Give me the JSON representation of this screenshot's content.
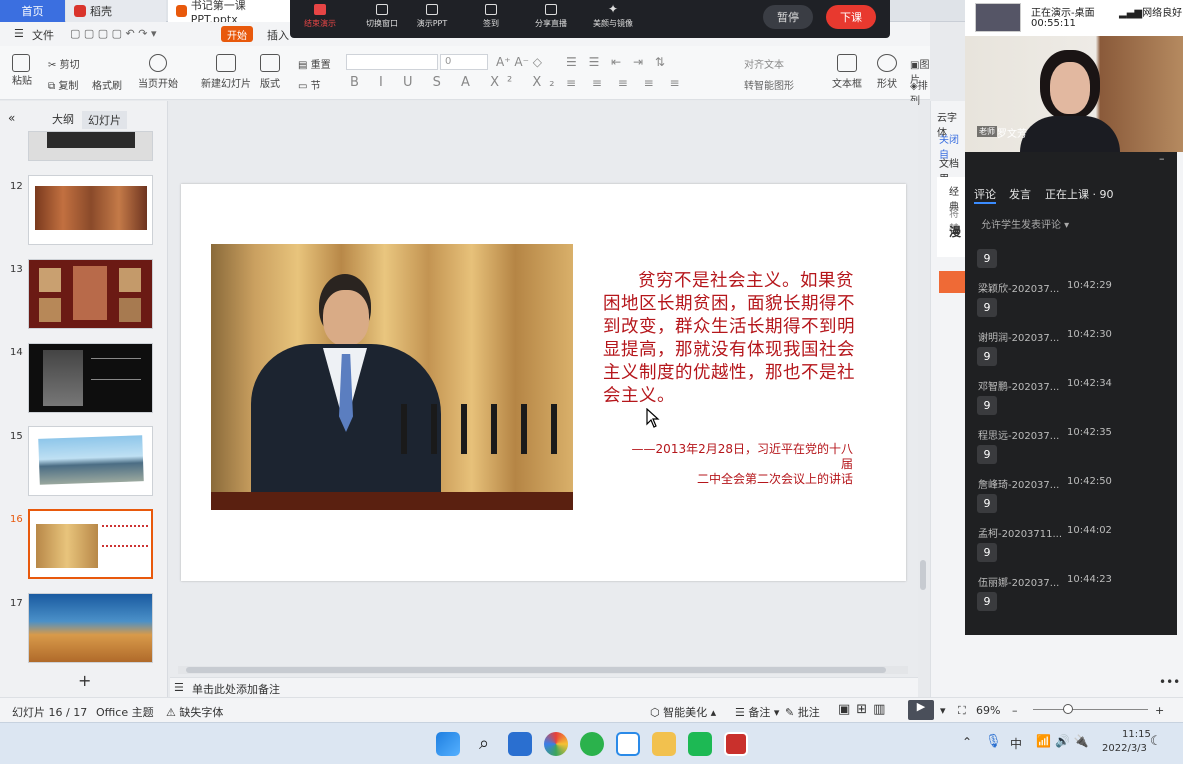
{
  "tabs": {
    "home": "首页",
    "daoke": "稻壳",
    "file": "书记第一课PPT.pptx"
  },
  "meeting": {
    "buttons": [
      "结束演示",
      "切换窗口",
      "演示PPT",
      "签到",
      "分享直播",
      "美颜与镜像"
    ],
    "pause": "暂停",
    "end_class": "下课"
  },
  "menu": {
    "file": "文件",
    "start": "开始",
    "insert": "插入"
  },
  "ribbon": {
    "paste": "粘贴",
    "cut": "剪切",
    "copy": "复制",
    "format_painter": "格式刷",
    "from_start": "当页开始",
    "new_slide": "新建幻灯片",
    "layout": "版式",
    "reset": "重置",
    "section": "节",
    "font_size": "0",
    "align_text": "对齐文本",
    "smart_graphic": "转智能图形",
    "textbox": "文本框",
    "shape": "形状",
    "picture": "图片",
    "arrange": "排列"
  },
  "left_panel": {
    "tab_outline": "大纲",
    "tab_slides": "幻灯片",
    "thumbs": [
      {
        "num": "12"
      },
      {
        "num": "13"
      },
      {
        "num": "14"
      },
      {
        "num": "15"
      },
      {
        "num": "16"
      },
      {
        "num": "17"
      }
    ],
    "add": "+"
  },
  "slide": {
    "quote": "贫穷不是社会主义。如果贫困地区长期贫困，面貌长期得不到改变，群众生活长期得不到明显提高，那就没有体现我国社会主义制度的优越性，那也不是社会主义。",
    "source_line1": "——2013年2月28日，习近平在党的十八届",
    "source_line2": "二中全会第二次会议上的讲话"
  },
  "notes": {
    "placeholder": "单击此处添加备注"
  },
  "right_side": {
    "cloud_font": "云字体",
    "close": "关闭自",
    "doc": "文档用",
    "classic": "经典",
    "will": "将替",
    "bold": "漫"
  },
  "status": {
    "slide_count": "幻灯片 16 / 17",
    "theme": "Office 主题",
    "missing_font": "缺失字体",
    "smart_beautify": "智能美化",
    "notes": "备注",
    "comments": "批注",
    "zoom": "69%"
  },
  "live": {
    "status": "正在演示-桌面",
    "timer": "00:55:11",
    "network": "网络良好",
    "teacher_tag": "老师",
    "teacher_name": "罗文芳"
  },
  "comments": {
    "tab_comment": "评论",
    "tab_speak": "发言",
    "tab_live": "正在上课 · 90",
    "allow": "允许学生发表评论",
    "items": [
      {
        "name": "梁颖欣-202037...",
        "time": "10:42:29",
        "msg": "9"
      },
      {
        "name": "谢明润-202037...",
        "time": "10:42:30",
        "msg": "9"
      },
      {
        "name": "邓智鹏-202037...",
        "time": "10:42:34",
        "msg": "9"
      },
      {
        "name": "程思远-202037...",
        "time": "10:42:35",
        "msg": "9"
      },
      {
        "name": "詹峰琦-202037...",
        "time": "10:42:50",
        "msg": "9"
      },
      {
        "name": "孟柯-20203711...",
        "time": "10:44:02",
        "msg": "9"
      },
      {
        "name": "伍丽娜-202037...",
        "time": "10:44:23",
        "msg": "9"
      }
    ],
    "first_msg": "9"
  },
  "taskbar": {
    "ime": "中",
    "time": "11:15",
    "date": "2022/3/3"
  }
}
